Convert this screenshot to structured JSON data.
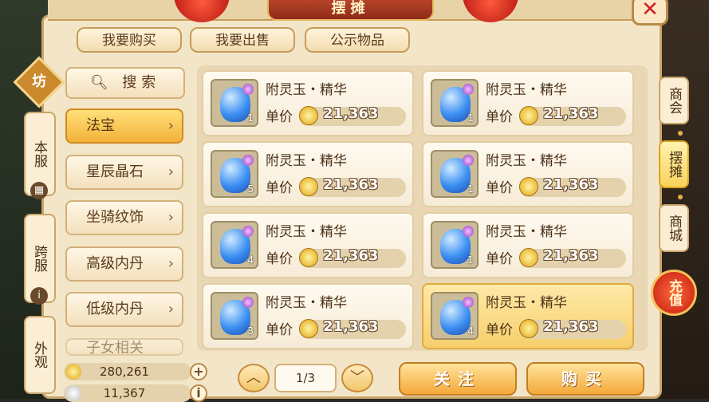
{
  "header": {
    "title": "摆摊",
    "close_label": "✕"
  },
  "top_tabs": [
    {
      "label": "我要购买"
    },
    {
      "label": "我要出售"
    },
    {
      "label": "公示物品"
    }
  ],
  "left_nav": {
    "emblem": "坊",
    "items": [
      {
        "label": "本服"
      },
      {
        "label": "跨服"
      },
      {
        "label": "外观"
      }
    ]
  },
  "categories": {
    "search_label": "搜索",
    "items": [
      {
        "label": "法宝",
        "active": true
      },
      {
        "label": "星辰晶石",
        "active": false
      },
      {
        "label": "坐骑纹饰",
        "active": false
      },
      {
        "label": "高级内丹",
        "active": false
      },
      {
        "label": "低级内丹",
        "active": false
      },
      {
        "label": "子女相关",
        "active": false
      }
    ]
  },
  "listings": {
    "price_label": "单价",
    "items": [
      {
        "name": "附灵玉・精华",
        "qty": "1",
        "price": "21,363",
        "selected": false
      },
      {
        "name": "附灵玉・精华",
        "qty": "1",
        "price": "21,363",
        "selected": false
      },
      {
        "name": "附灵玉・精华",
        "qty": "5",
        "price": "21,363",
        "selected": false
      },
      {
        "name": "附灵玉・精华",
        "qty": "1",
        "price": "21,363",
        "selected": false
      },
      {
        "name": "附灵玉・精华",
        "qty": "4",
        "price": "21,363",
        "selected": false
      },
      {
        "name": "附灵玉・精华",
        "qty": "1",
        "price": "21,363",
        "selected": false
      },
      {
        "name": "附灵玉・精华",
        "qty": "3",
        "price": "21,363",
        "selected": false
      },
      {
        "name": "附灵玉・精华",
        "qty": "4",
        "price": "21,363",
        "selected": true
      }
    ]
  },
  "currency": {
    "gold": "280,261",
    "silver": "11,367"
  },
  "pagination": {
    "current": "1/3"
  },
  "actions": {
    "follow_label": "关注",
    "buy_label": "购买"
  },
  "right_nav": {
    "items": [
      {
        "label": "商会",
        "active": false
      },
      {
        "label": "摆摊",
        "active": true
      },
      {
        "label": "商城",
        "active": false
      }
    ],
    "recharge_label": "充值"
  },
  "colors": {
    "accent": "#f3b23a",
    "panel": "#f3e6c8",
    "text": "#4a2f16"
  }
}
